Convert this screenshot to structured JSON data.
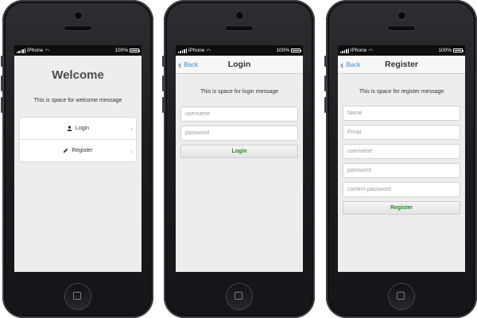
{
  "status_bar": {
    "carrier": "iPhone",
    "battery": "100%"
  },
  "welcome_screen": {
    "title": "Welcome",
    "message": "This is space for welcome message",
    "menu": [
      {
        "label": "Login",
        "icon": "user-icon"
      },
      {
        "label": "Register",
        "icon": "pencil-icon"
      }
    ]
  },
  "login_screen": {
    "back_label": "Back",
    "title": "Login",
    "message": "This is space for login message",
    "fields": [
      {
        "placeholder": "username"
      },
      {
        "placeholder": "password"
      }
    ],
    "submit_label": "Login"
  },
  "register_screen": {
    "back_label": "Back",
    "title": "Register",
    "message": "This is space for register message",
    "fields": [
      {
        "placeholder": "Name"
      },
      {
        "placeholder": "Email"
      },
      {
        "placeholder": "username"
      },
      {
        "placeholder": "password"
      },
      {
        "placeholder": "confirm password"
      }
    ],
    "submit_label": "Register"
  },
  "colors": {
    "accent": "#3c8ed6",
    "submit_text": "#1e8a1e"
  }
}
